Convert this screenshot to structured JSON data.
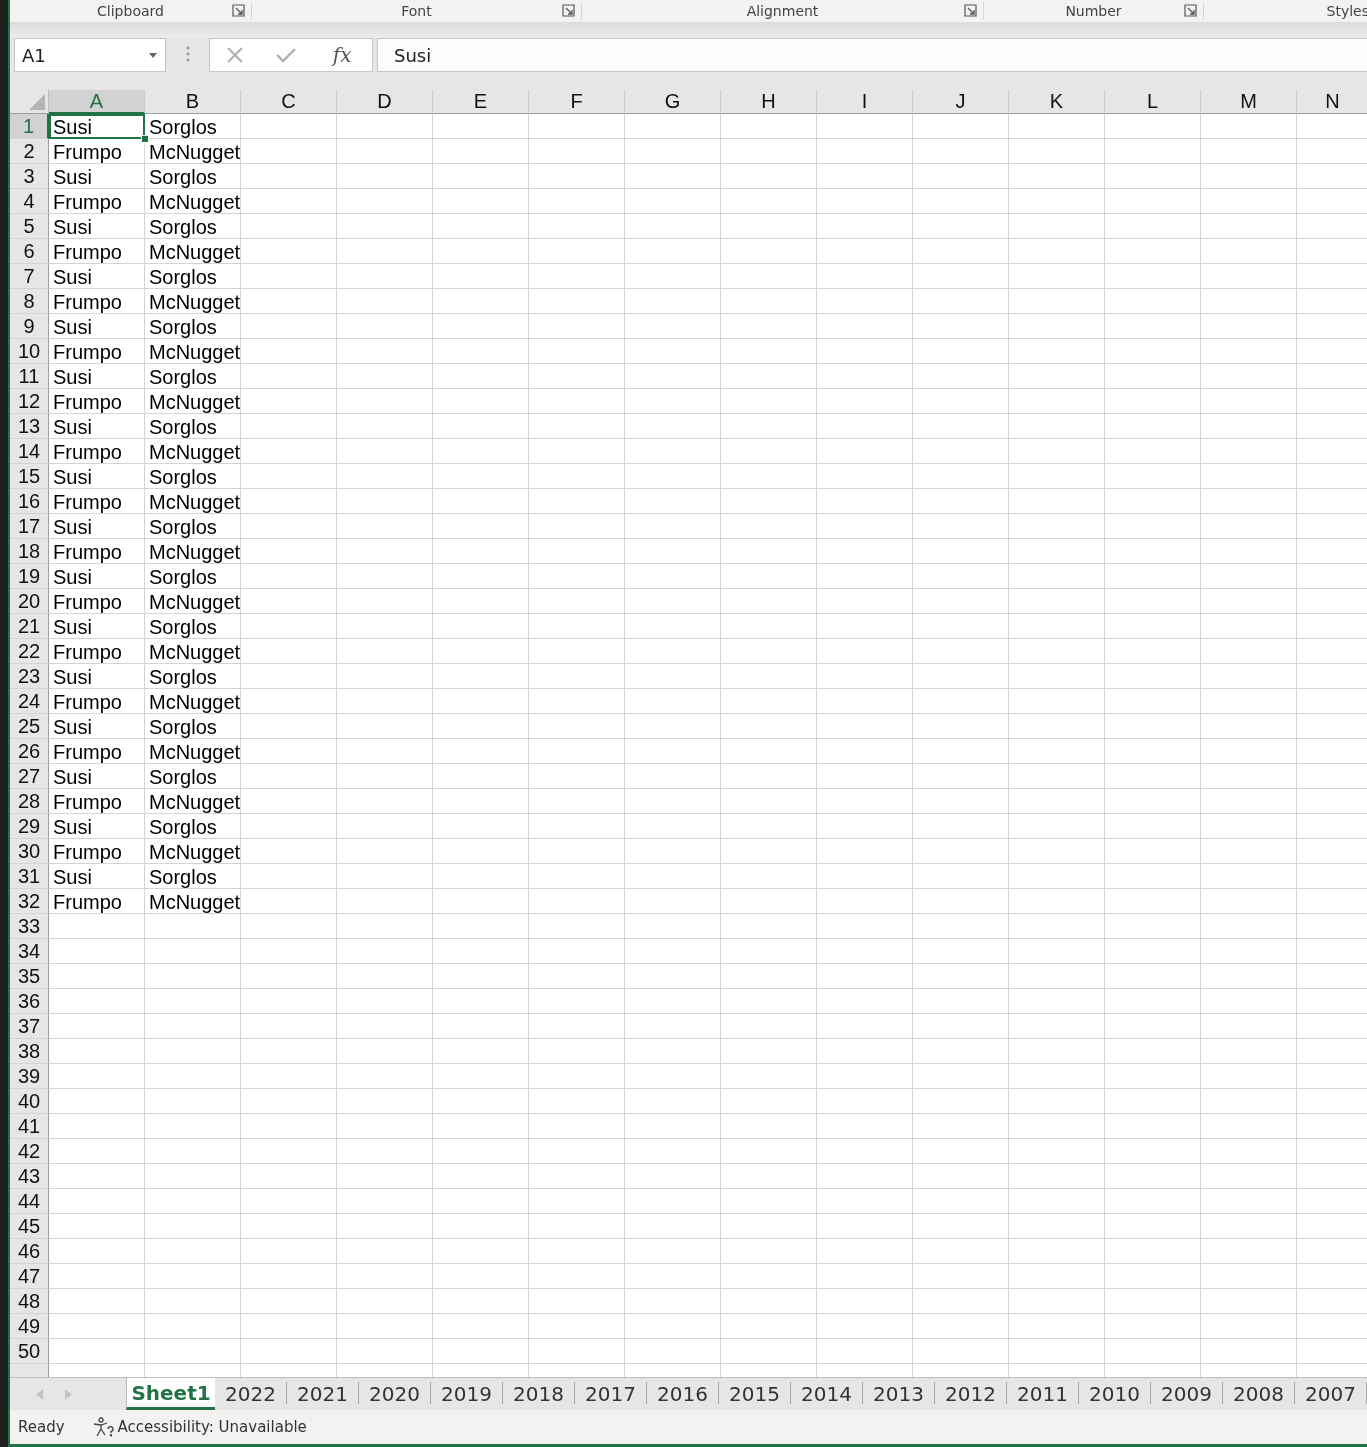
{
  "ribbon_groups": [
    {
      "label": "Clipboard",
      "launcher": true
    },
    {
      "label": "Font",
      "launcher": true
    },
    {
      "label": "Alignment",
      "launcher": true
    },
    {
      "label": "Number",
      "launcher": true
    },
    {
      "label": "Styles",
      "launcher": false
    }
  ],
  "formula_bar": {
    "name_box": "A1",
    "function_label": "fx",
    "value": "Susi"
  },
  "columns": [
    {
      "label": "A",
      "selected": true
    },
    {
      "label": "B",
      "selected": false
    },
    {
      "label": "C",
      "selected": false
    },
    {
      "label": "D",
      "selected": false
    },
    {
      "label": "E",
      "selected": false
    },
    {
      "label": "F",
      "selected": false
    },
    {
      "label": "G",
      "selected": false
    },
    {
      "label": "H",
      "selected": false
    },
    {
      "label": "I",
      "selected": false
    },
    {
      "label": "J",
      "selected": false
    },
    {
      "label": "K",
      "selected": false
    },
    {
      "label": "L",
      "selected": false
    },
    {
      "label": "M",
      "selected": false
    },
    {
      "label": "N",
      "selected": false
    }
  ],
  "rows": [
    {
      "number": "1",
      "selected": true,
      "cells": [
        {
          "text": "Susi",
          "selected": true
        },
        {
          "text": "Sorglos",
          "selected": false
        }
      ]
    },
    {
      "number": "2",
      "selected": false,
      "cells": [
        {
          "text": "Frumpo",
          "selected": false
        },
        {
          "text": "McNugget",
          "selected": false
        }
      ]
    },
    {
      "number": "3",
      "selected": false,
      "cells": [
        {
          "text": "Susi",
          "selected": false
        },
        {
          "text": "Sorglos",
          "selected": false
        }
      ]
    },
    {
      "number": "4",
      "selected": false,
      "cells": [
        {
          "text": "Frumpo",
          "selected": false
        },
        {
          "text": "McNugget",
          "selected": false
        }
      ]
    },
    {
      "number": "5",
      "selected": false,
      "cells": [
        {
          "text": "Susi",
          "selected": false
        },
        {
          "text": "Sorglos",
          "selected": false
        }
      ]
    },
    {
      "number": "6",
      "selected": false,
      "cells": [
        {
          "text": "Frumpo",
          "selected": false
        },
        {
          "text": "McNugget",
          "selected": false
        }
      ]
    },
    {
      "number": "7",
      "selected": false,
      "cells": [
        {
          "text": "Susi",
          "selected": false
        },
        {
          "text": "Sorglos",
          "selected": false
        }
      ]
    },
    {
      "number": "8",
      "selected": false,
      "cells": [
        {
          "text": "Frumpo",
          "selected": false
        },
        {
          "text": "McNugget",
          "selected": false
        }
      ]
    },
    {
      "number": "9",
      "selected": false,
      "cells": [
        {
          "text": "Susi",
          "selected": false
        },
        {
          "text": "Sorglos",
          "selected": false
        }
      ]
    },
    {
      "number": "10",
      "selected": false,
      "cells": [
        {
          "text": "Frumpo",
          "selected": false
        },
        {
          "text": "McNugget",
          "selected": false
        }
      ]
    },
    {
      "number": "11",
      "selected": false,
      "cells": [
        {
          "text": "Susi",
          "selected": false
        },
        {
          "text": "Sorglos",
          "selected": false
        }
      ]
    },
    {
      "number": "12",
      "selected": false,
      "cells": [
        {
          "text": "Frumpo",
          "selected": false
        },
        {
          "text": "McNugget",
          "selected": false
        }
      ]
    },
    {
      "number": "13",
      "selected": false,
      "cells": [
        {
          "text": "Susi",
          "selected": false
        },
        {
          "text": "Sorglos",
          "selected": false
        }
      ]
    },
    {
      "number": "14",
      "selected": false,
      "cells": [
        {
          "text": "Frumpo",
          "selected": false
        },
        {
          "text": "McNugget",
          "selected": false
        }
      ]
    },
    {
      "number": "15",
      "selected": false,
      "cells": [
        {
          "text": "Susi",
          "selected": false
        },
        {
          "text": "Sorglos",
          "selected": false
        }
      ]
    },
    {
      "number": "16",
      "selected": false,
      "cells": [
        {
          "text": "Frumpo",
          "selected": false
        },
        {
          "text": "McNugget",
          "selected": false
        }
      ]
    },
    {
      "number": "17",
      "selected": false,
      "cells": [
        {
          "text": "Susi",
          "selected": false
        },
        {
          "text": "Sorglos",
          "selected": false
        }
      ]
    },
    {
      "number": "18",
      "selected": false,
      "cells": [
        {
          "text": "Frumpo",
          "selected": false
        },
        {
          "text": "McNugget",
          "selected": false
        }
      ]
    },
    {
      "number": "19",
      "selected": false,
      "cells": [
        {
          "text": "Susi",
          "selected": false
        },
        {
          "text": "Sorglos",
          "selected": false
        }
      ]
    },
    {
      "number": "20",
      "selected": false,
      "cells": [
        {
          "text": "Frumpo",
          "selected": false
        },
        {
          "text": "McNugget",
          "selected": false
        }
      ]
    },
    {
      "number": "21",
      "selected": false,
      "cells": [
        {
          "text": "Susi",
          "selected": false
        },
        {
          "text": "Sorglos",
          "selected": false
        }
      ]
    },
    {
      "number": "22",
      "selected": false,
      "cells": [
        {
          "text": "Frumpo",
          "selected": false
        },
        {
          "text": "McNugget",
          "selected": false
        }
      ]
    },
    {
      "number": "23",
      "selected": false,
      "cells": [
        {
          "text": "Susi",
          "selected": false
        },
        {
          "text": "Sorglos",
          "selected": false
        }
      ]
    },
    {
      "number": "24",
      "selected": false,
      "cells": [
        {
          "text": "Frumpo",
          "selected": false
        },
        {
          "text": "McNugget",
          "selected": false
        }
      ]
    },
    {
      "number": "25",
      "selected": false,
      "cells": [
        {
          "text": "Susi",
          "selected": false
        },
        {
          "text": "Sorglos",
          "selected": false
        }
      ]
    },
    {
      "number": "26",
      "selected": false,
      "cells": [
        {
          "text": "Frumpo",
          "selected": false
        },
        {
          "text": "McNugget",
          "selected": false
        }
      ]
    },
    {
      "number": "27",
      "selected": false,
      "cells": [
        {
          "text": "Susi",
          "selected": false
        },
        {
          "text": "Sorglos",
          "selected": false
        }
      ]
    },
    {
      "number": "28",
      "selected": false,
      "cells": [
        {
          "text": "Frumpo",
          "selected": false
        },
        {
          "text": "McNugget",
          "selected": false
        }
      ]
    },
    {
      "number": "29",
      "selected": false,
      "cells": [
        {
          "text": "Susi",
          "selected": false
        },
        {
          "text": "Sorglos",
          "selected": false
        }
      ]
    },
    {
      "number": "30",
      "selected": false,
      "cells": [
        {
          "text": "Frumpo",
          "selected": false
        },
        {
          "text": "McNugget",
          "selected": false
        }
      ]
    },
    {
      "number": "31",
      "selected": false,
      "cells": [
        {
          "text": "Susi",
          "selected": false
        },
        {
          "text": "Sorglos",
          "selected": false
        }
      ]
    },
    {
      "number": "32",
      "selected": false,
      "cells": [
        {
          "text": "Frumpo",
          "selected": false
        },
        {
          "text": "McNugget",
          "selected": false
        }
      ]
    },
    {
      "number": "33",
      "selected": false,
      "cells": []
    },
    {
      "number": "34",
      "selected": false,
      "cells": []
    },
    {
      "number": "35",
      "selected": false,
      "cells": []
    },
    {
      "number": "36",
      "selected": false,
      "cells": []
    },
    {
      "number": "37",
      "selected": false,
      "cells": []
    },
    {
      "number": "38",
      "selected": false,
      "cells": []
    },
    {
      "number": "39",
      "selected": false,
      "cells": []
    },
    {
      "number": "40",
      "selected": false,
      "cells": []
    },
    {
      "number": "41",
      "selected": false,
      "cells": []
    },
    {
      "number": "42",
      "selected": false,
      "cells": []
    },
    {
      "number": "43",
      "selected": false,
      "cells": []
    },
    {
      "number": "44",
      "selected": false,
      "cells": []
    },
    {
      "number": "45",
      "selected": false,
      "cells": []
    },
    {
      "number": "46",
      "selected": false,
      "cells": []
    },
    {
      "number": "47",
      "selected": false,
      "cells": []
    },
    {
      "number": "48",
      "selected": false,
      "cells": []
    },
    {
      "number": "49",
      "selected": false,
      "cells": []
    },
    {
      "number": "50",
      "selected": false,
      "cells": []
    }
  ],
  "sheet_tabs": [
    {
      "label": "Sheet1",
      "selected": true
    },
    {
      "label": "2022",
      "selected": false
    },
    {
      "label": "2021",
      "selected": false
    },
    {
      "label": "2020",
      "selected": false
    },
    {
      "label": "2019",
      "selected": false
    },
    {
      "label": "2018",
      "selected": false
    },
    {
      "label": "2017",
      "selected": false
    },
    {
      "label": "2016",
      "selected": false
    },
    {
      "label": "2015",
      "selected": false
    },
    {
      "label": "2014",
      "selected": false
    },
    {
      "label": "2013",
      "selected": false
    },
    {
      "label": "2012",
      "selected": false
    },
    {
      "label": "2011",
      "selected": false
    },
    {
      "label": "2010",
      "selected": false
    },
    {
      "label": "2009",
      "selected": false
    },
    {
      "label": "2008",
      "selected": false
    },
    {
      "label": "2007",
      "selected": false
    }
  ],
  "status_bar": {
    "status": "Ready",
    "accessibility": "Accessibility: Unavailable"
  }
}
